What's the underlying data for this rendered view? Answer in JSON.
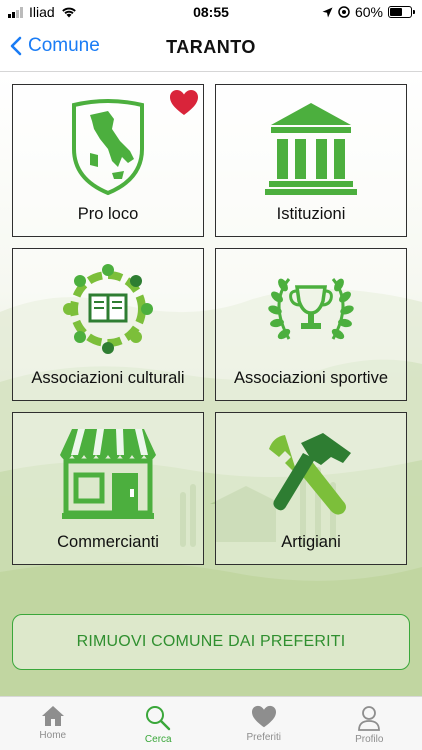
{
  "status_bar": {
    "carrier": "Iliad",
    "time": "08:55",
    "battery_percent": "60%",
    "battery_level": 0.6,
    "icons": [
      "signal-icon",
      "wifi-icon",
      "location-arrow-icon",
      "alarm-lock-icon",
      "battery-icon"
    ]
  },
  "nav": {
    "back_label": "Comune",
    "title": "TARANTO"
  },
  "tiles": [
    {
      "label": "Pro loco",
      "icon": "italy-shield-icon",
      "favorite": true
    },
    {
      "label": "Istituzioni",
      "icon": "institution-building-icon"
    },
    {
      "label": "Associazioni culturali",
      "icon": "people-book-circle-icon"
    },
    {
      "label": "Associazioni sportive",
      "icon": "trophy-laurel-icon"
    },
    {
      "label": "Commercianti",
      "icon": "shop-storefront-icon"
    },
    {
      "label": "Artigiani",
      "icon": "hammer-wrench-icon"
    }
  ],
  "remove_button_label": "RIMUOVI COMUNE DAI PREFERITI",
  "tab_bar": {
    "active": "Cerca",
    "tabs": [
      {
        "label": "Home",
        "icon": "home-icon"
      },
      {
        "label": "Cerca",
        "icon": "search-icon"
      },
      {
        "label": "Preferiti",
        "icon": "heart-icon"
      },
      {
        "label": "Profilo",
        "icon": "user-icon"
      }
    ]
  },
  "colors": {
    "accent_green": "#3aa73a",
    "icon_green": "#4caf3e",
    "link_blue": "#1a7cf5",
    "favorite_red": "#d9243a"
  }
}
